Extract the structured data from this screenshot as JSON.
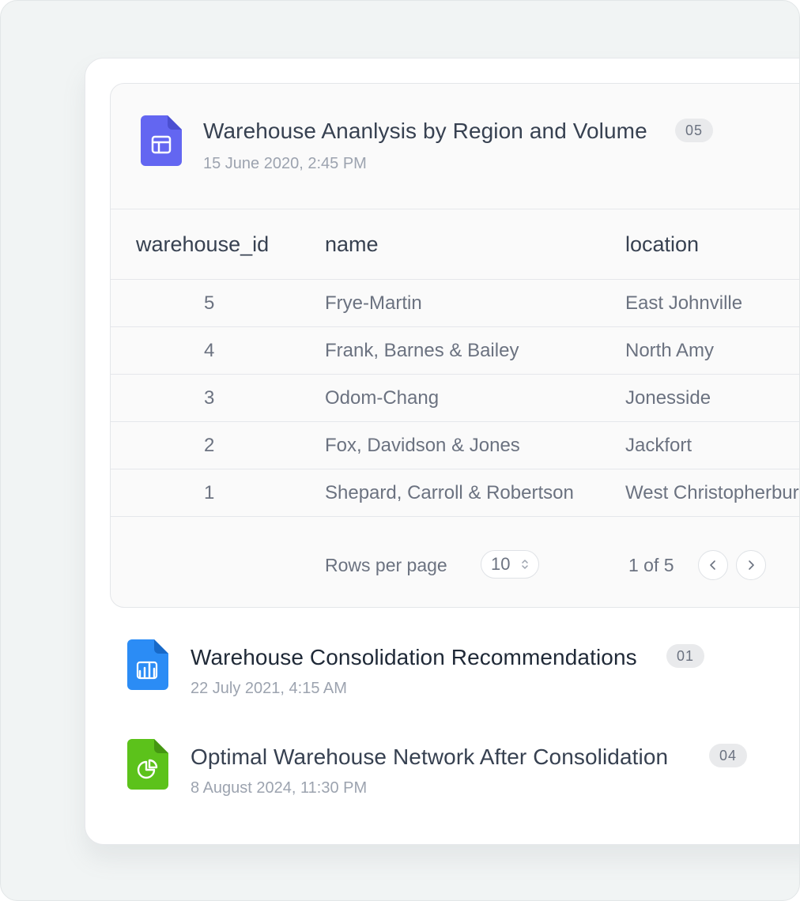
{
  "main_card": {
    "title": "Warehouse Ananlysis by Region and Volume",
    "date": "15 June 2020, 2:45 PM",
    "badge": "05",
    "icon": "table-file-icon",
    "icon_color": "#6366f1",
    "columns": [
      "warehouse_id",
      "name",
      "location"
    ],
    "rows": [
      {
        "id": "5",
        "name": "Frye-Martin",
        "location": "East Johnville"
      },
      {
        "id": "4",
        "name": "Frank, Barnes & Bailey",
        "location": "North Amy"
      },
      {
        "id": "3",
        "name": "Odom-Chang",
        "location": "Jonesside"
      },
      {
        "id": "2",
        "name": "Fox, Davidson & Jones",
        "location": "Jackfort"
      },
      {
        "id": "1",
        "name": "Shepard, Carroll & Robertson",
        "location": "West Christopherburg"
      }
    ],
    "pagination": {
      "rows_per_page_label": "Rows per page",
      "rows_per_page_value": "10",
      "page_info": "1 of 5"
    }
  },
  "reports": [
    {
      "title": "Warehouse Consolidation Recommendations",
      "date": "22 July 2021, 4:15 AM",
      "badge": "01",
      "icon": "bar-chart-file-icon",
      "color": "#2b8cf5"
    },
    {
      "title": "Optimal Warehouse Network After Consolidation",
      "date": "8 August 2024, 11:30 PM",
      "badge": "04",
      "icon": "pie-chart-file-icon",
      "color": "#5cc21b"
    }
  ]
}
